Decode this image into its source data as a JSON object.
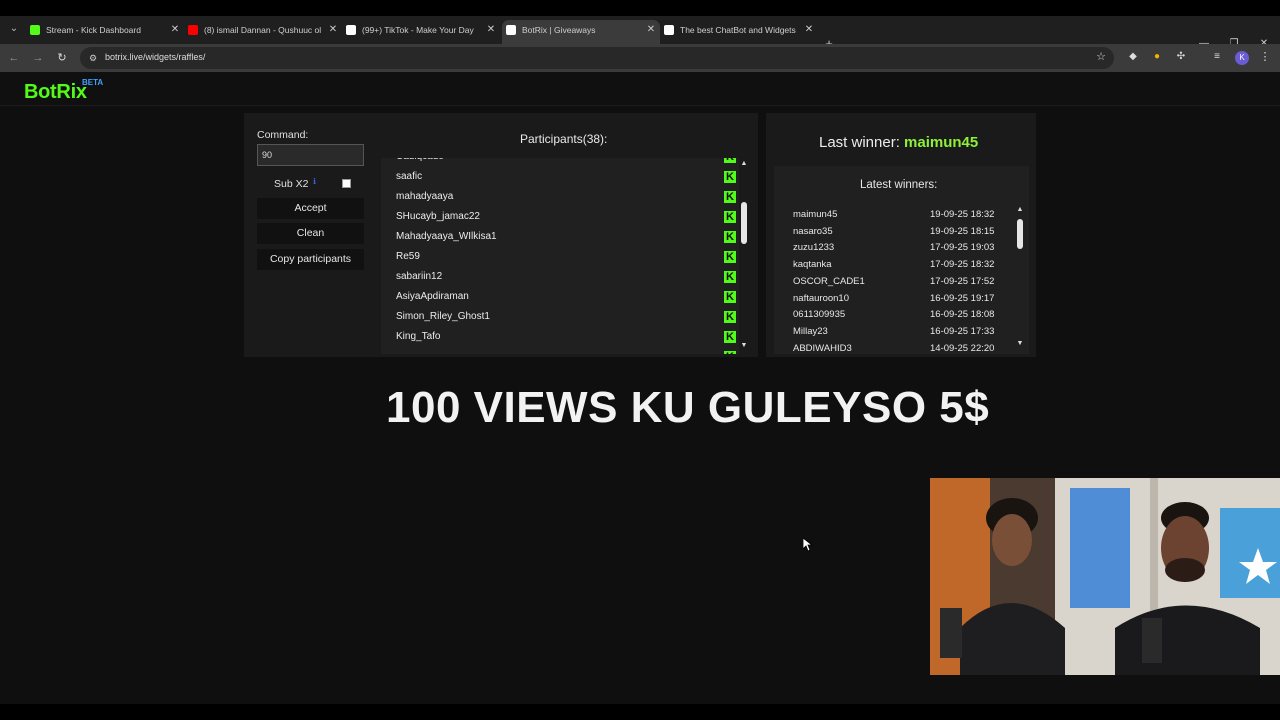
{
  "browser": {
    "tabs": [
      {
        "title": "Stream - Kick Dashboard",
        "active": false,
        "favicon_color": "#53fc18",
        "favicon": "kick-icon"
      },
      {
        "title": "(8) ismail Dannan - Qushuuc ol",
        "active": false,
        "favicon_color": "#ff0000",
        "favicon": "youtube-icon"
      },
      {
        "title": "(99+) TikTok - Make Your Day",
        "active": false,
        "favicon_color": "#ffffff",
        "favicon": "tiktok-icon"
      },
      {
        "title": "BotRix | Giveaways",
        "active": true,
        "favicon_color": "#ffffff",
        "favicon": "botrix-icon"
      },
      {
        "title": "The best ChatBot and Widgets",
        "active": false,
        "favicon_color": "#ffffff",
        "favicon": "botrix-icon"
      }
    ],
    "url": "botrix.live/widgets/raffles/",
    "profile_initial": "K"
  },
  "site": {
    "logo": "BotRix",
    "logo_badge": "BETA"
  },
  "controls": {
    "command_label": "Command:",
    "command_value": "90",
    "sub_label": "Sub X2",
    "sub_info": "ℹ",
    "sub_checked": false,
    "accept_label": "Accept",
    "clean_label": "Clean",
    "copy_label": "Copy participants"
  },
  "participants": {
    "title": "Participants(38):",
    "items": [
      "Cadiqcade",
      "saafic",
      "mahadyaaya",
      "SHucayb_jamac22",
      "Mahadyaaya_WIlkisa1",
      "Re59",
      "sabariin12",
      "AsiyaApdiraman",
      "Simon_Riley_Ghost1",
      "King_Tafo"
    ],
    "platform_badge": "K"
  },
  "winners": {
    "last_winner_label": "Last winner:",
    "last_winner_name": "maimun45",
    "latest_title": "Latest winners:",
    "rows": [
      {
        "name": "maimun45",
        "date": "19-09-25 18:32"
      },
      {
        "name": "nasaro35",
        "date": "19-09-25 18:15"
      },
      {
        "name": "zuzu1233",
        "date": "17-09-25 19:03"
      },
      {
        "name": "kaqtanka",
        "date": "17-09-25 18:32"
      },
      {
        "name": "OSCOR_CADE1",
        "date": "17-09-25 17:52"
      },
      {
        "name": "naftauroon10",
        "date": "16-09-25 19:17"
      },
      {
        "name": "0611309935",
        "date": "16-09-25 18:08"
      },
      {
        "name": "Millay23",
        "date": "16-09-25 17:33"
      },
      {
        "name": "ABDIWAHID3",
        "date": "14-09-25 22:20"
      }
    ]
  },
  "banner": "100 VIEWS KU GULEYSO 5$"
}
